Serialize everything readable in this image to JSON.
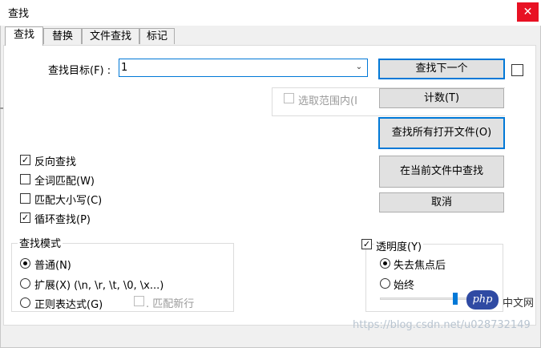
{
  "window": {
    "title": "查找",
    "close": "✕"
  },
  "tabs": [
    {
      "label": "查找",
      "active": true
    },
    {
      "label": "替换",
      "active": false
    },
    {
      "label": "文件查找",
      "active": false
    },
    {
      "label": "标记",
      "active": false
    }
  ],
  "find": {
    "label": "查找目标(F) :",
    "value": "1",
    "dropdown_icon": "chevron-down-icon"
  },
  "in_selection": {
    "label": "选取范围内(I",
    "checked": false,
    "enabled": false
  },
  "buttons": {
    "find_next": "查找下一个",
    "count": "计数(T)",
    "find_all_open": "查找所有打开文件(O)",
    "find_in_current": "在当前文件中查找",
    "cancel": "取消"
  },
  "options": [
    {
      "label": "反向查找",
      "checked": true
    },
    {
      "label": "全词匹配(W)",
      "checked": false
    },
    {
      "label": "匹配大小写(C)",
      "checked": false
    },
    {
      "label": "循环查找(P)",
      "checked": true
    }
  ],
  "search_mode": {
    "title": "查找模式",
    "modes": [
      {
        "label": "普通(N)",
        "selected": true
      },
      {
        "label": "扩展(X) (\\n, \\r, \\t, \\0, \\x...)",
        "selected": false
      },
      {
        "label": "正则表达式(G)",
        "selected": false
      }
    ],
    "dot_newline": {
      "label": ". 匹配新行",
      "checked": false,
      "enabled": false
    }
  },
  "transparency": {
    "label": "透明度(Y)",
    "checked": true,
    "options": [
      {
        "label": "失去焦点后",
        "selected": true
      },
      {
        "label": "始终",
        "selected": false
      }
    ],
    "level": 0.7
  },
  "overlay": {
    "php_logo": "php",
    "php_cn": "中文网",
    "watermark": "https://blog.csdn.net/u028732149"
  },
  "colors": {
    "accent": "#0078d7",
    "close": "#e81123"
  }
}
